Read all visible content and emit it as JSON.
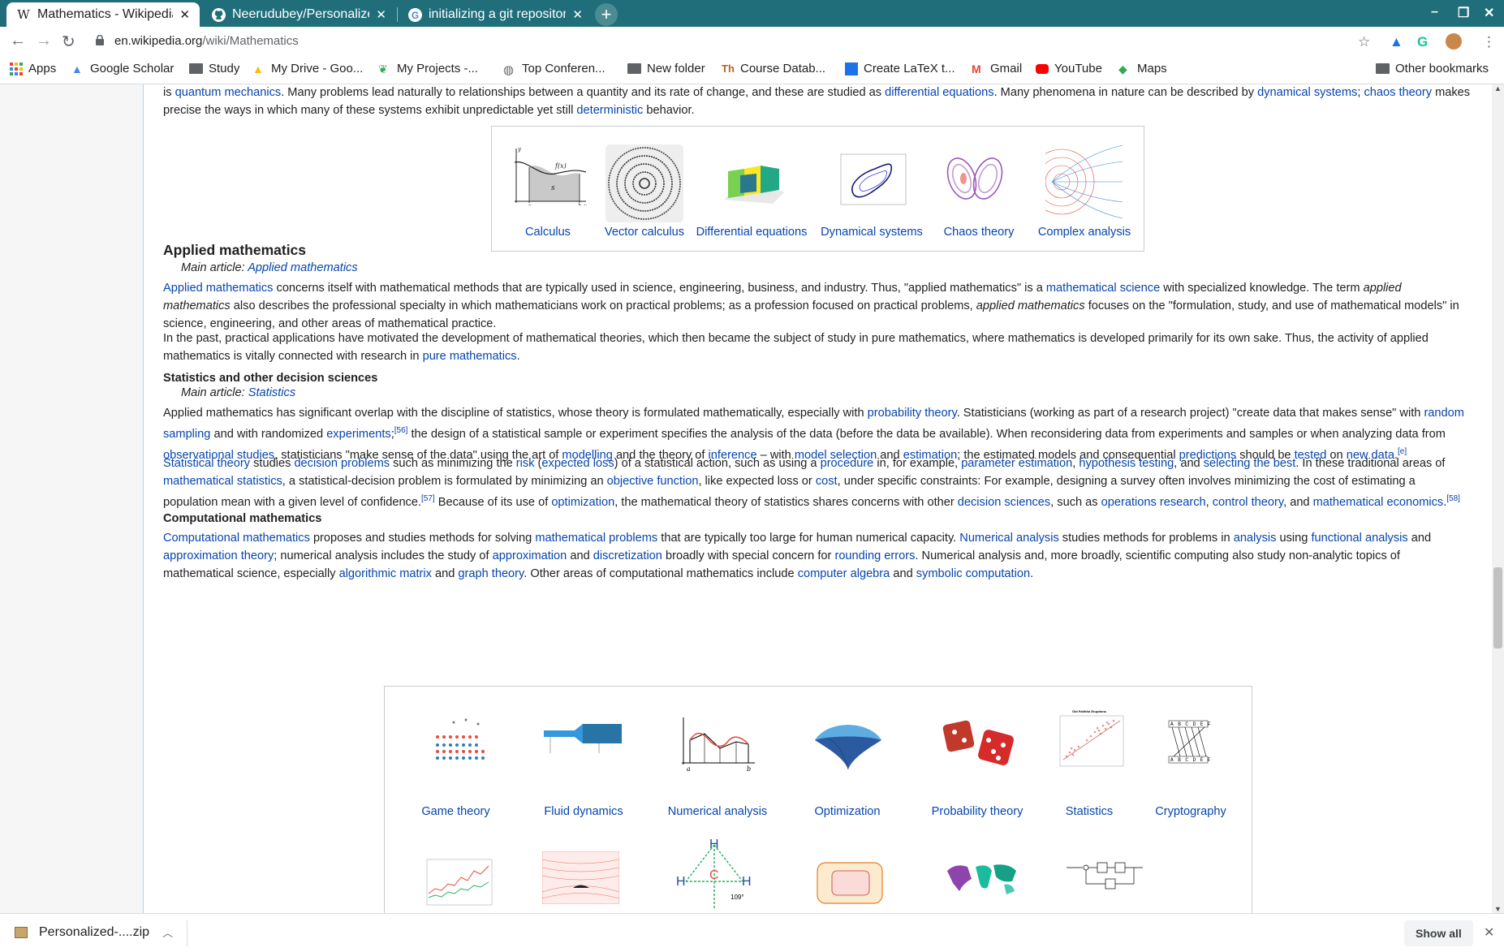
{
  "tabs": [
    {
      "title": "Mathematics - Wikipedia",
      "icon": "W"
    },
    {
      "title": "Neerudubey/Personalized",
      "icon": "github-icon"
    },
    {
      "title": "initializing a git repository",
      "icon": "google-icon"
    }
  ],
  "toolbar": {
    "url_domain": "en.wikipedia.org",
    "url_path": "/wiki/Mathematics"
  },
  "bookmarks": {
    "items": [
      "Apps",
      "Google Scholar",
      "Study",
      "My Drive - Goo...",
      "My Projects -...",
      "Top Conferen...",
      "New folder",
      "Course Datab...",
      "Create LaTeX t...",
      "Gmail",
      "YouTube",
      "Maps"
    ],
    "other": "Other bookmarks"
  },
  "article": {
    "intro_tail": {
      "t1": "is ",
      "l1": "quantum mechanics",
      "t2": ". Many problems lead naturally to relationships between a quantity and its rate of change, and these are studied as ",
      "l2": "differential equations",
      "t3": ". Many phenomena in nature can be described by ",
      "l3": "dynamical systems",
      "t4": "; ",
      "l4": "chaos theory",
      "t5": " makes precise the ways in which many of these systems exhibit unpredictable yet still ",
      "l5": "deterministic",
      "t6": " behavior."
    },
    "gallery1": [
      "Calculus",
      "Vector calculus",
      "Differential equations",
      "Dynamical systems",
      "Chaos theory",
      "Complex analysis"
    ],
    "applied_heading": "Applied mathematics",
    "applied_main_prefix": "Main article: ",
    "applied_main_link": "Applied mathematics",
    "applied_p1": {
      "l1": "Applied mathematics",
      "t1": " concerns itself with mathematical methods that are typically used in science, engineering, business, and industry. Thus, \"applied mathematics\" is a ",
      "l2": "mathematical science",
      "t2": " with specialized knowledge. The term ",
      "i1": "applied mathematics",
      "t3": " also describes the professional specialty in which mathematicians work on practical problems; as a profession focused on practical problems, ",
      "i2": "applied mathematics",
      "t4": " focuses on the \"formulation, study, and use of mathematical models\" in science, engineering, and other areas of mathematical practice."
    },
    "applied_p2": {
      "t1": "In the past, practical applications have motivated the development of mathematical theories, which then became the subject of study in pure mathematics, where mathematics is developed primarily for its own sake. Thus, the activity of applied mathematics is vitally connected with research in ",
      "l1": "pure mathematics",
      "t2": "."
    },
    "stats_heading": "Statistics and other decision sciences",
    "stats_main_prefix": "Main article: ",
    "stats_main_link": "Statistics",
    "stats_p1": {
      "t1": "Applied mathematics has significant overlap with the discipline of statistics, whose theory is formulated mathematically, especially with ",
      "l1": "probability theory",
      "t2": ". Statisticians (working as part of a research project) \"create data that makes sense\" with ",
      "l2": "random sampling",
      "t3": " and with randomized ",
      "l3": "experiments",
      "s1": "[56]",
      "t4": " the design of a statistical sample or experiment specifies the analysis of the data (before the data be available). When reconsidering data from experiments and samples or when analyzing data from ",
      "l4": "observational studies",
      "t5": ", statisticians \"make sense of the data\" using the art of ",
      "l5": "modelling",
      "t6": " and the theory of ",
      "l6": "inference",
      "t7": " – with ",
      "l7": "model selection",
      "t8": " and ",
      "l8": "estimation",
      "t9": "; the estimated models and consequential ",
      "l9": "predictions",
      "t10": " should be ",
      "l10": "tested",
      "t11": " on ",
      "l11": "new data",
      "t12": ".",
      "s2": "[e]"
    },
    "stats_p2": {
      "l1": "Statistical theory",
      "t1": " studies ",
      "l2": "decision problems",
      "t2": " such as minimizing the ",
      "l3": "risk",
      "t3": " (",
      "l4": "expected loss",
      "t4": ") of a statistical action, such as using a ",
      "l5": "procedure",
      "t5": " in, for example, ",
      "l6": "parameter estimation",
      "t6": ", ",
      "l7": "hypothesis testing",
      "t7": ", and ",
      "l8": "selecting the best",
      "t8": ". In these traditional areas of ",
      "l9": "mathematical statistics",
      "t9": ", a statistical-decision problem is formulated by minimizing an ",
      "l10": "objective function",
      "t10": ", like expected loss or ",
      "l11": "cost",
      "t11": ", under specific constraints: For example, designing a survey often involves minimizing the cost of estimating a population mean with a given level of confidence.",
      "s1": "[57]",
      "t12": " Because of its use of ",
      "l12": "optimization",
      "t13": ", the mathematical theory of statistics shares concerns with other ",
      "l13": "decision sciences",
      "t14": ", such as ",
      "l14": "operations research",
      "t15": ", ",
      "l15": "control theory",
      "t16": ", and ",
      "l16": "mathematical economics",
      "t17": ".",
      "s2": "[58]"
    },
    "comp_heading": "Computational mathematics",
    "comp_p1": {
      "l1": "Computational mathematics",
      "t1": " proposes and studies methods for solving ",
      "l2": "mathematical problems",
      "t2": " that are typically too large for human numerical capacity. ",
      "l3": "Numerical analysis",
      "t3": " studies methods for problems in ",
      "l4": "analysis",
      "t4": " using ",
      "l5": "functional analysis",
      "t5": " and ",
      "l6": "approximation theory",
      "t6": "; numerical analysis includes the study of ",
      "l7": "approximation",
      "t7": " and ",
      "l8": "discretization",
      "t8": " broadly with special concern for ",
      "l9": "rounding errors",
      "t9": ". Numerical analysis and, more broadly, scientific computing also study non-analytic topics of mathematical science, especially ",
      "l10": "algorithmic matrix",
      "t10": " and ",
      "l11": "graph theory",
      "t11": ". Other areas of computational mathematics include ",
      "l12": "computer algebra",
      "t12": " and ",
      "l13": "symbolic computation",
      "t13": "."
    },
    "gallery2": [
      "Game theory",
      "Fluid dynamics",
      "Numerical analysis",
      "Optimization",
      "Probability theory",
      "Statistics",
      "Cryptography"
    ],
    "img_labels": {
      "calc_fx": "f(x)",
      "calc_s": "s",
      "calc_a": "a",
      "calc_b": "b",
      "calc_x": "x",
      "calc_y": "y",
      "num_a": "a",
      "num_b": "b",
      "crypto_top": "A B C D E F",
      "crypto_bot": "A B C D E F",
      "methane_h": "H",
      "methane_c": "C",
      "methane_angle": "109°",
      "stats_title": "Old Faithful Eruptions"
    }
  },
  "download": {
    "filename": "Personalized-....zip",
    "show_all": "Show all"
  },
  "colors": {
    "tabstrip": "#1f6e7a",
    "link": "#0645ad"
  }
}
